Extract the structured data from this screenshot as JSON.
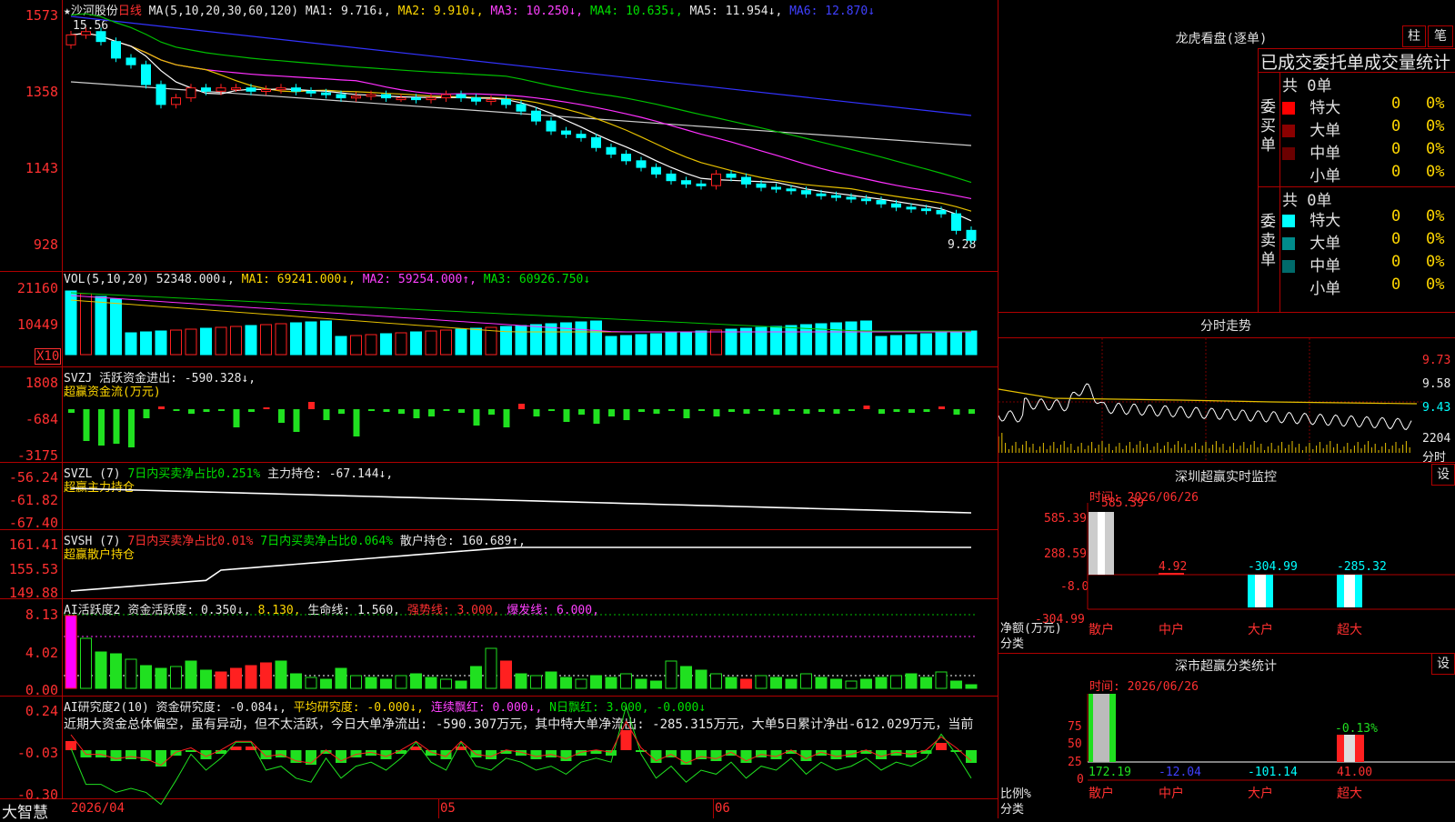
{
  "stock": {
    "name": "★沙河股份",
    "period": "日线",
    "ma_formula": "MA(5,10,20,30,60,120)",
    "ma1": "MA1: 9.716↓,",
    "ma2": "MA2: 9.910↓,",
    "ma3": "MA3: 10.250↓,",
    "ma4": "MA4: 10.635↓,",
    "ma5": "MA5: 11.954↓,",
    "ma6": "MA6: 12.870↓",
    "high_label": "15.56",
    "low_label": "9.28",
    "price_axis": [
      "1573",
      "1358",
      "1143",
      "928"
    ]
  },
  "vol": {
    "title": "VOL(5,10,20)",
    "v": "52348.000↓,",
    "ma1": "MA1: 69241.000↓,",
    "ma2": "MA2: 59254.000↑,",
    "ma3": "MA3: 60926.750↓",
    "axis": [
      "21160",
      "10449"
    ],
    "unit": "X10"
  },
  "svzj": {
    "title": "SVZJ",
    "line1": "活跃资金进出: -590.328↓,",
    "line2": "超赢资金流(万元)",
    "axis": [
      "1808",
      "-684",
      "-3175"
    ]
  },
  "svzl": {
    "title": "SVZL (7)",
    "ratio": "7日内买卖净占比0.251%",
    "pos": "主力持仓: -67.144↓,",
    "line2": "超赢主力持仓",
    "axis": [
      "-56.24",
      "-61.82",
      "-67.40"
    ]
  },
  "svsh": {
    "title": "SVSH (7)",
    "ratio1": "7日内买卖净占比0.01%",
    "ratio2": "7日内买卖净占比0.064%",
    "pos": "散户持仓: 160.689↑,",
    "line2": "超赢散户持仓",
    "axis": [
      "161.41",
      "155.53",
      "149.88"
    ]
  },
  "ai1": {
    "title": "AI活跃度2",
    "a": "资金活跃度: 0.350↓,",
    "b": "8.130,",
    "c": "生命线: 1.560,",
    "d": "强势线: 3.000,",
    "e": "爆发线: 6.000,",
    "axis": [
      "8.13",
      "4.02",
      "0.00"
    ]
  },
  "ai2": {
    "title": "AI研究度2(10)",
    "a": "资金研究度: -0.084↓,",
    "b": "平均研究度: -0.000↓,",
    "c": "连续飘红: 0.000↓,",
    "d": "N日飘红: 3.000,",
    "e": "-0.000↓",
    "comment": "近期大资金总体偏空，虽有异动，但不太活跃，今日大单净流出: -590.307万元，其中特大单净流出: -285.315万元，大单5日累计净出-612.029万元，当前",
    "axis": [
      "0.24",
      "-0.03",
      "-0.30"
    ]
  },
  "bottom": {
    "brand": "大智慧",
    "dates": [
      "2026/04",
      "05",
      "06"
    ]
  },
  "right": {
    "dragon_title": "龙虎看盘(逐单)",
    "tab1": "柱",
    "tab2": "笔",
    "section_title": "已成交委托单成交量统计",
    "buy_total": "共 0单",
    "buy_label": "委买单",
    "sell_total": "共 0单",
    "sell_label": "委卖单",
    "sizes": [
      "特大",
      "大单",
      "中单",
      "小单"
    ],
    "count": "0",
    "pct": "0%",
    "buy_colors": [
      "#ff0000",
      "#8b0000",
      "#6b0000",
      "#000000"
    ],
    "sell_colors": [
      "#00ffff",
      "#008b8b",
      "#006b6b",
      "#000000"
    ],
    "intraday_title": "分时走势",
    "intraday_axis": [
      "9.73",
      "9.58",
      "9.43",
      "2204",
      "分时"
    ],
    "monitor_title": "深圳超赢实时监控",
    "monitor_set": "设",
    "monitor_time": "时间: 2026/06/26",
    "monitor_axis": [
      "585.39",
      "288.59",
      "-8.0",
      "-304.99"
    ],
    "monitor_values": [
      "585.39",
      "4.92",
      "-304.99",
      "-285.32"
    ],
    "monitor_unit": "净额(万元)",
    "monitor_cat": "分类",
    "categories": [
      "散户",
      "中户",
      "大户",
      "超大"
    ],
    "stats_title": "深市超赢分类统计",
    "stats_set": "设",
    "stats_time": "时间: 2026/06/26",
    "stats_axis": [
      "75",
      "50",
      "25",
      "0"
    ],
    "stats_top_value": "-0.13%",
    "stats_values": [
      "172.19",
      "-12.04",
      "-101.14",
      "41.00"
    ],
    "stats_unit": "比例%",
    "stats_cat": "分类"
  }
}
